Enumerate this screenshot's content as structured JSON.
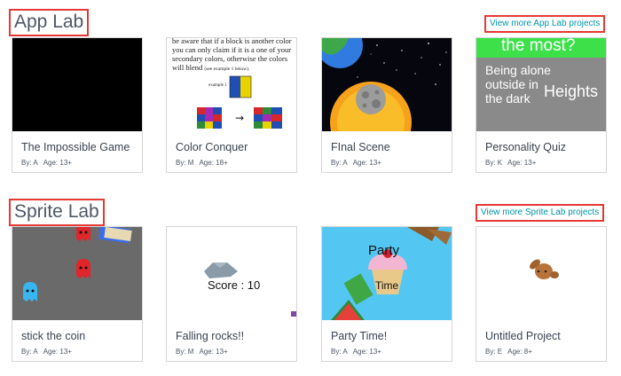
{
  "app_lab": {
    "title": "App Lab",
    "view_more": "View more App Lab projects",
    "projects": [
      {
        "title": "The Impossible Game",
        "author": "By: A",
        "age": "Age: 13+"
      },
      {
        "title": "Color Conquer",
        "author": "By: M",
        "age": "Age: 18+",
        "thumb_text": "be aware that if a block is another color you can only claim if it is a one of your secondary colors,  otherwise the colors will blend",
        "thumb_text_small": "(see example 1 below).",
        "thumb_example": "example 1"
      },
      {
        "title": "FInal Scene",
        "author": "By: A",
        "age": "Age: 13+"
      },
      {
        "title": "Personality Quiz",
        "author": "By: K",
        "age": "Age: 13+",
        "thumb_header": "the most?",
        "thumb_option1": "Being alone outside in the dark",
        "thumb_option2": "Heights"
      }
    ]
  },
  "sprite_lab": {
    "title": "Sprite Lab",
    "view_more": "View more Sprite Lab projects",
    "projects": [
      {
        "title": "stick the coin",
        "author": "By: A",
        "age": "Age: 13+"
      },
      {
        "title": "Falling rocks!!",
        "author": "By: M",
        "age": "Age: 13+",
        "thumb_score": "Score : 10"
      },
      {
        "title": "Party Time!",
        "author": "By: A",
        "age": "Age: 13+",
        "thumb_party": "Party",
        "thumb_time": "Time"
      },
      {
        "title": "Untitled Project",
        "author": "By: E",
        "age": "Age: 8+"
      }
    ]
  },
  "colors": {
    "accent_link": "#0094a8",
    "highlight_border": "#e53935",
    "text": "#4d5766"
  }
}
